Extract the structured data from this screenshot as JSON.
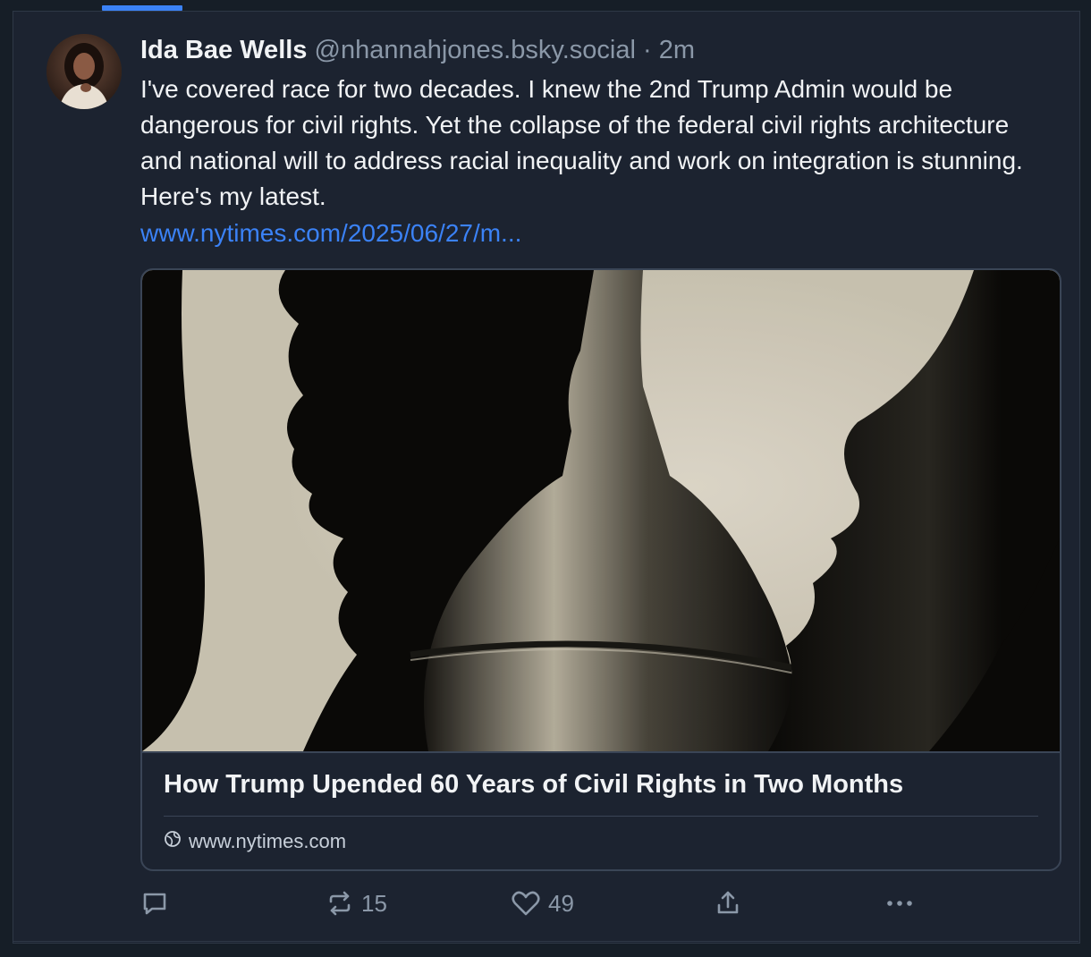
{
  "post": {
    "author_name": "Ida Bae Wells",
    "handle": "@nhannahjones.bsky.social",
    "separator": "·",
    "time": "2m",
    "text": "I've covered race for two decades. I knew the 2nd Trump Admin would be dangerous for civil rights. Yet the collapse of the federal civil rights architecture and national will to address racial inequality and work on integration is stunning. Here's my latest.",
    "link_text": "www.nytimes.com/2025/06/27/m..."
  },
  "card": {
    "title": "How Trump Upended 60 Years of Civil Rights in Two Months",
    "domain": "www.nytimes.com",
    "image_icon": "silhouette-capitol-illustration"
  },
  "actions": {
    "reply_icon": "reply-icon",
    "repost_count": "15",
    "like_count": "49",
    "share_icon": "share-icon",
    "more_icon": "more-icon"
  },
  "colors": {
    "background": "#1c2330",
    "link": "#3b82f6",
    "muted": "#8b98a8",
    "text": "#f1f3f5"
  }
}
